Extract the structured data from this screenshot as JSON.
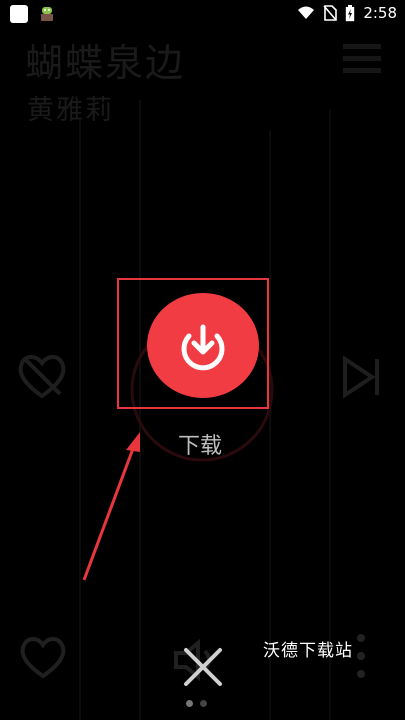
{
  "status_bar": {
    "time": "2:58"
  },
  "player": {
    "song_title": "蝴蝶泉边",
    "artist": "黄雅莉"
  },
  "action": {
    "download_label": "下载"
  },
  "watermark": "沃德下载站",
  "colors": {
    "accent": "#f23c43",
    "highlight": "#e8363d",
    "background": "#000000"
  },
  "icons": [
    "app-icon",
    "android-icon",
    "wifi-icon",
    "no-sim-icon",
    "battery-icon",
    "menu-icon",
    "dislike-icon",
    "download-icon",
    "next-icon",
    "heart-icon",
    "volume-icon",
    "close-icon",
    "more-icon"
  ]
}
